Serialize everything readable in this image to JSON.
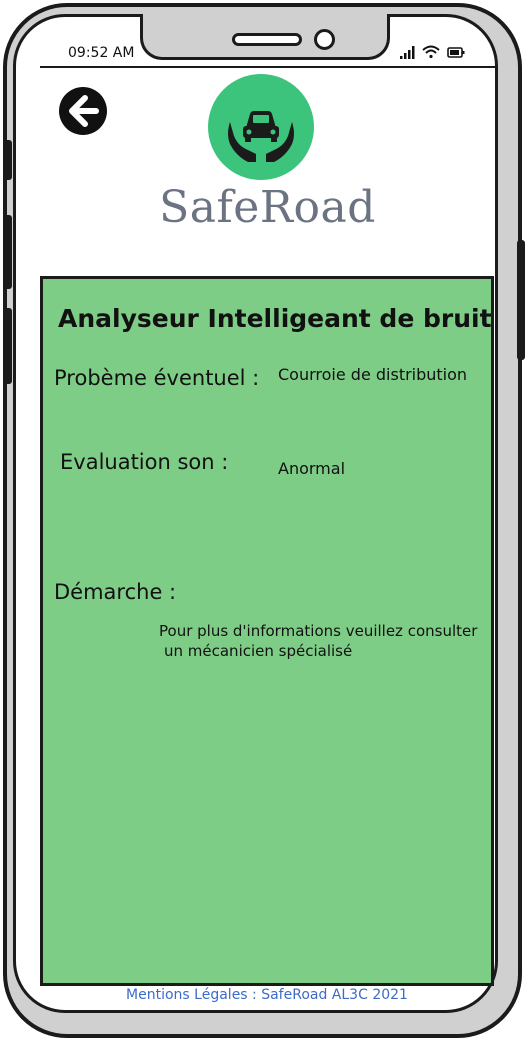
{
  "status_bar": {
    "time": "09:52 AM",
    "icons": [
      "signal-icon",
      "wifi-icon",
      "battery-icon"
    ]
  },
  "header": {
    "back_icon": "arrow-left-icon",
    "logo_icon": "car-in-hands-icon",
    "brand": "SafeRoad"
  },
  "panel": {
    "title": "Analyseur Intelligeant de bruit",
    "problem_label": "Probème éventuel :",
    "problem_value": "Courroie de distribution",
    "evaluation_label": "Evaluation son :",
    "evaluation_value": "Anormal",
    "approach_label": "Démarche :",
    "approach_line1": "Pour plus d'informations veuillez consulter",
    "approach_line2": "un mécanicien spécialisé"
  },
  "footer": {
    "legal": "Mentions Légales : SafeRoad AL3C 2021"
  },
  "colors": {
    "logo_green": "#3cc47c",
    "panel_green": "#7ecd87",
    "brand_gray": "#6b7383",
    "link_blue": "#3d6bc9"
  }
}
